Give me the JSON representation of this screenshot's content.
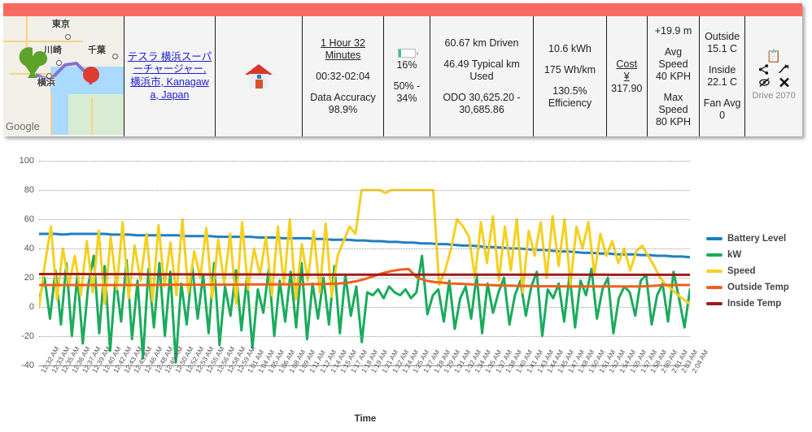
{
  "summary": {
    "map": {
      "labels": [
        "東京",
        "川崎",
        "千葉",
        "横浜"
      ],
      "watermark": "Google",
      "start_marker_color": "#5da32a",
      "end_marker_color": "#e03b2f",
      "route_color": "#8470d6"
    },
    "destination": {
      "link_text": "テスラ 横浜スーパーチャージャー, 横浜市, Kanagawa, Japan"
    },
    "home_icon": "house-icon",
    "duration": {
      "headline": "1 Hour 32 Minutes",
      "range": "00:32-02:04",
      "accuracy_label": "Data Accuracy",
      "accuracy_value": "98.9%"
    },
    "battery": {
      "percent_used": "16%",
      "percent_fill": 16,
      "range": "50% - 34%"
    },
    "distance": {
      "driven": "60.67 km Driven",
      "typical": "46.49 Typical km Used",
      "odo": "ODO 30,625.20 - 30,685.86"
    },
    "energy": {
      "kwh": "10.6 kWh",
      "consumption": "175 Wh/km",
      "efficiency": "130.5% Efficiency"
    },
    "cost": {
      "label": "Cost",
      "currency": "¥",
      "value": "317.90"
    },
    "speed": {
      "elevation": "+19.9 m",
      "avg_label": "Avg Speed",
      "avg_value": "40 KPH",
      "max_label": "Max Speed",
      "max_value": "80 KPH"
    },
    "temp": {
      "outside_label": "Outside",
      "outside_value": "15.1 C",
      "inside_label": "Inside",
      "inside_value": "22.1 C",
      "fan_label": "Fan Avg",
      "fan_value": "0"
    },
    "actions": {
      "notes_icon": "clipboard-icon",
      "share_icon": "share-icon",
      "forward_icon": "arrow-forward-icon",
      "hide_icon": "eye-slash-icon",
      "delete_icon": "close-x-icon",
      "drive_id": "Drive 2070"
    }
  },
  "chart_data": {
    "type": "line",
    "title": "",
    "xlabel": "Time",
    "ylabel": "",
    "ylim": [
      -40,
      100
    ],
    "yticks": [
      -40,
      -20,
      0,
      20,
      40,
      60,
      80,
      100
    ],
    "grid": true,
    "legend_position": "right",
    "x_tick_labels": [
      "12:32 AM",
      "12:33 AM",
      "12:35 AM",
      "12:36 AM",
      "12:37 AM",
      "12:39 AM",
      "12:40 AM",
      "12:42 AM",
      "12:43 AM",
      "12:45 AM",
      "12:46 AM",
      "12:48 AM",
      "12:49 AM",
      "12:50 AM",
      "12:52 AM",
      "12:53 AM",
      "12:55 AM",
      "12:56 AM",
      "12:58 AM",
      "12:59 AM",
      "1:01 AM",
      "1:04 AM",
      "1:05 AM",
      "1:06 AM",
      "1:08 AM",
      "1:09 AM",
      "1:11 AM",
      "1:12 AM",
      "1:14 AM",
      "1:15 AM",
      "1:17 AM",
      "1:18 AM",
      "1:19 AM",
      "1:21 AM",
      "1:22 AM",
      "1:24 AM",
      "1:25 AM",
      "1:27 AM",
      "1:28 AM",
      "1:29 AM",
      "1:31 AM",
      "1:32 AM",
      "1:34 AM",
      "1:35 AM",
      "1:37 AM",
      "1:38 AM",
      "1:40 AM",
      "1:41 AM",
      "1:43 AM",
      "1:44 AM",
      "1:45 AM",
      "1:47 AM",
      "1:48 AM",
      "1:50 AM",
      "1:51 AM",
      "1:52 AM",
      "1:54 AM",
      "1:55 AM",
      "1:57 AM",
      "1:58 AM",
      "2:00 AM",
      "2:01 AM",
      "2:03 AM",
      "2:04 AM"
    ],
    "series": [
      {
        "name": "Battery Level",
        "color": "#1f7fc4",
        "unit": "%",
        "values": [
          50,
          50,
          50,
          49.5,
          50,
          50,
          50,
          50,
          50,
          49.5,
          49.5,
          49.5,
          49,
          49,
          49,
          49,
          49,
          49,
          48.5,
          48.5,
          48.5,
          48.5,
          48,
          48,
          48,
          48,
          48,
          47.5,
          47.5,
          47.5,
          47,
          47,
          47,
          47,
          46.5,
          46.5,
          46,
          46,
          46,
          45.5,
          45.5,
          45,
          45,
          44.5,
          44.5,
          44,
          44,
          43.5,
          43.5,
          43,
          43,
          42.5,
          42,
          42,
          41.5,
          41,
          41,
          40.5,
          40,
          40,
          39.5,
          39,
          39,
          38.5,
          38,
          38,
          37.5,
          37,
          37,
          36.5,
          36.5,
          36,
          36,
          36,
          35.5,
          35.5,
          35,
          35,
          34.5,
          34.5,
          34
        ]
      },
      {
        "name": "kW",
        "color": "#1aab5c",
        "unit": "kW",
        "values": [
          5,
          20,
          -8,
          25,
          -12,
          30,
          -20,
          22,
          -25,
          15,
          35,
          -18,
          28,
          -30,
          20,
          -10,
          32,
          -22,
          18,
          -35,
          26,
          -14,
          30,
          -20,
          24,
          -38,
          16,
          -12,
          28,
          -8,
          22,
          -18,
          30,
          -26,
          14,
          -6,
          25,
          -16,
          20,
          -28,
          12,
          -4,
          26,
          -20,
          18,
          -10,
          24,
          -14,
          30,
          -22,
          16,
          -8,
          20,
          -12,
          28,
          -18,
          22,
          -6,
          14,
          -24,
          10,
          8,
          12,
          6,
          14,
          10,
          8,
          12,
          6,
          10,
          35,
          -5,
          8,
          12,
          -10,
          18,
          -15,
          6,
          14,
          -8,
          22,
          -18,
          16,
          -4,
          10,
          20,
          -12,
          8,
          18,
          -6,
          14,
          24,
          -20,
          12,
          6,
          16,
          -10,
          22,
          -14,
          18,
          8,
          26,
          -8,
          12,
          20,
          -18,
          6,
          14,
          10,
          -6,
          18,
          22,
          -12,
          8,
          16,
          -10,
          24,
          6,
          -14,
          12
        ]
      },
      {
        "name": "Speed",
        "color": "#f5d020",
        "unit": "KPH",
        "values": [
          0,
          30,
          55,
          5,
          40,
          15,
          35,
          8,
          45,
          10,
          52,
          2,
          48,
          12,
          58,
          6,
          42,
          18,
          50,
          4,
          56,
          14,
          44,
          8,
          60,
          10,
          38,
          20,
          54,
          6,
          46,
          16,
          50,
          2,
          58,
          12,
          40,
          22,
          48,
          8,
          55,
          15,
          60,
          5,
          43,
          18,
          52,
          10,
          57,
          7,
          35,
          45,
          55,
          50,
          80,
          80,
          80,
          80,
          78,
          80,
          80,
          80,
          80,
          80,
          80,
          80,
          80,
          15,
          25,
          40,
          60,
          55,
          48,
          20,
          58,
          30,
          62,
          18,
          55,
          25,
          60,
          10,
          52,
          35,
          58,
          20,
          62,
          28,
          60,
          15,
          55,
          40,
          58,
          22,
          50,
          35,
          45,
          30,
          40,
          25,
          38,
          42,
          35,
          28,
          20,
          15,
          12,
          8,
          5,
          2
        ]
      },
      {
        "name": "Outside Temp",
        "color": "#f0601a",
        "unit": "C",
        "values": [
          15,
          15,
          15,
          15,
          15,
          15,
          15,
          15,
          15,
          15,
          15,
          15,
          15,
          15,
          15.2,
          15.2,
          15.2,
          15.2,
          15.2,
          15.2,
          15.3,
          15.3,
          15.3,
          15.3,
          15.4,
          15.4,
          15.4,
          15.4,
          15.5,
          15.5,
          15.5,
          15.6,
          15.6,
          15.8,
          16,
          16.5,
          17.5,
          19,
          21,
          23,
          24.5,
          25.5,
          26,
          20,
          18,
          17,
          16.5,
          16,
          15.8,
          15.5,
          15.2,
          15,
          14.8,
          14.6,
          14.5,
          14.4,
          14.3,
          14.2,
          14.2,
          14.1,
          14.1,
          14,
          14,
          14,
          14,
          14,
          14,
          14,
          14,
          14.2,
          14.5,
          15,
          15,
          15,
          15
        ]
      },
      {
        "name": "Inside Temp",
        "color": "#9e1b1b",
        "unit": "C",
        "values": [
          22.5,
          22.5,
          22.5,
          22.5,
          22.5,
          22.5,
          22.4,
          22.4,
          22.4,
          22.4,
          22.4,
          22.4,
          22.3,
          22.3,
          22.3,
          22.3,
          22.3,
          22.3,
          22.3,
          22.2,
          22.2,
          22.2,
          22.2,
          22.2,
          22.2,
          22.2,
          22.2,
          22.1,
          22.1,
          22.1,
          22.1,
          22.1,
          22.1,
          22.1,
          22.1,
          22.1,
          22.1,
          22.1,
          22.1,
          22.1,
          22.1,
          22.1,
          22.1,
          22.1,
          22.1,
          22.1,
          22.1,
          22.1,
          22.1,
          22.1,
          22.1,
          22.1,
          22.1,
          22.1,
          22.1,
          22.1,
          22.1,
          22.1,
          22.1,
          22.1,
          22.1,
          22.1,
          22.1,
          22.1,
          22.1,
          22,
          22,
          22,
          22,
          22,
          22,
          22,
          22,
          22,
          22
        ]
      }
    ]
  }
}
